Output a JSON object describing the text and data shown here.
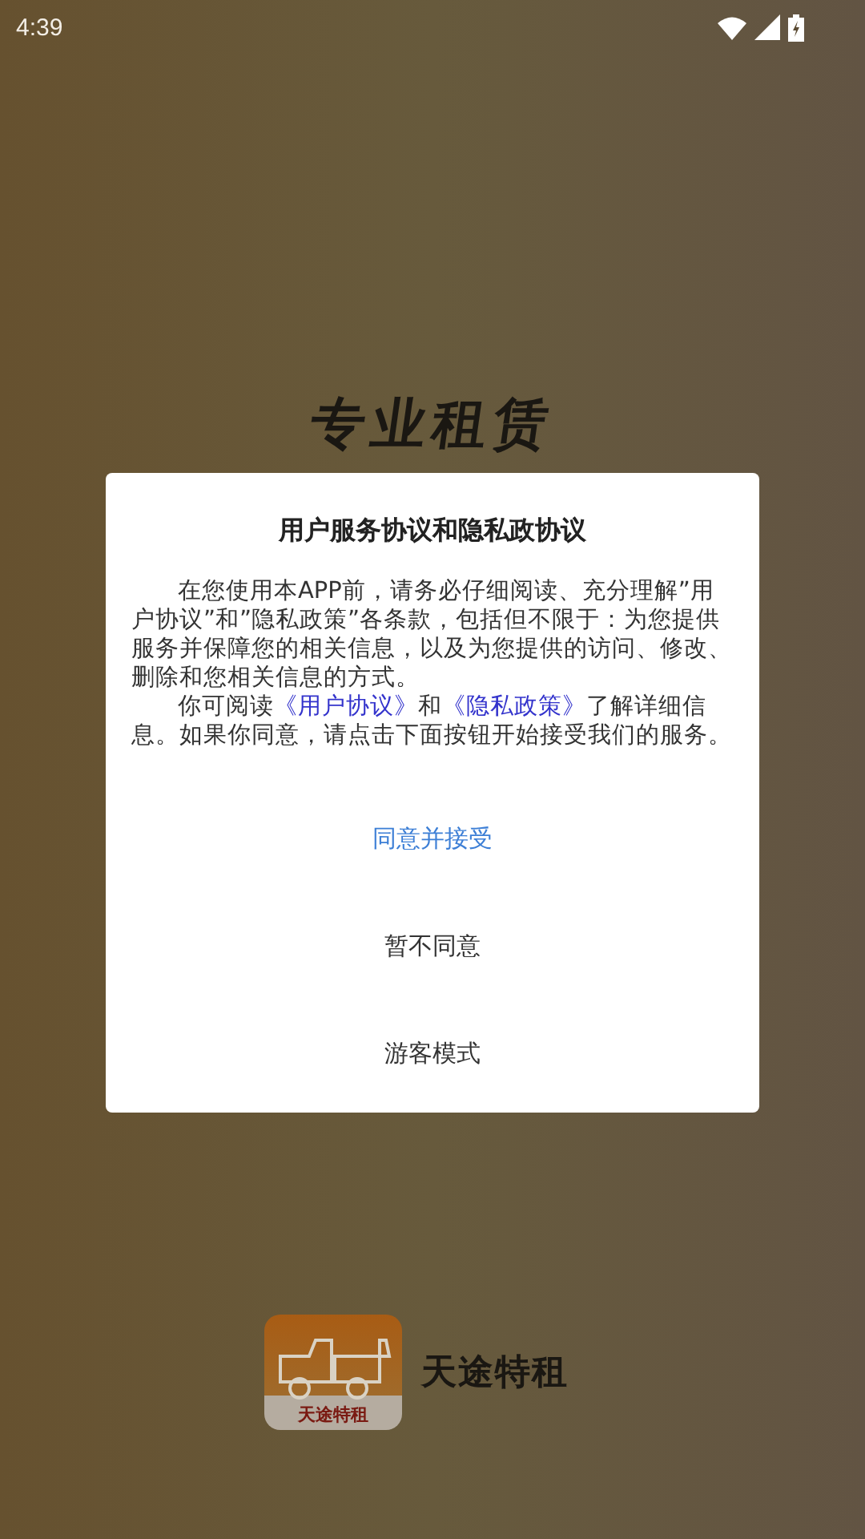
{
  "status_bar": {
    "time": "4:39"
  },
  "splash": {
    "slogan": "专业租赁",
    "app_name": "天途特租",
    "logo_label": "天途特租"
  },
  "dialog": {
    "title": "用户服务协议和隐私政协议",
    "paragraphs": [
      [
        {
          "kind": "text",
          "text": "在您使用本APP前，请务必仔细阅读、充分理解”用户协议”和”隐私政策”各条款，包括但不限于：为您提供服务并保障您的相关信息，以及为您提供的访问、修改、删除和您相关信息的方式。"
        }
      ],
      [
        {
          "kind": "text",
          "text": "你可阅读"
        },
        {
          "kind": "link",
          "text": "《用户协议》"
        },
        {
          "kind": "text",
          "text": "和"
        },
        {
          "kind": "link",
          "text": "《隐私政策》"
        },
        {
          "kind": "text",
          "text": "了解详细信息。如果你同意，请点击下面按钮开始接受我们的服务。"
        }
      ]
    ],
    "buttons": [
      {
        "label": "同意并接受",
        "kind": "primary"
      },
      {
        "label": "暂不同意",
        "kind": "plain"
      },
      {
        "label": "游客模式",
        "kind": "plain"
      }
    ]
  }
}
